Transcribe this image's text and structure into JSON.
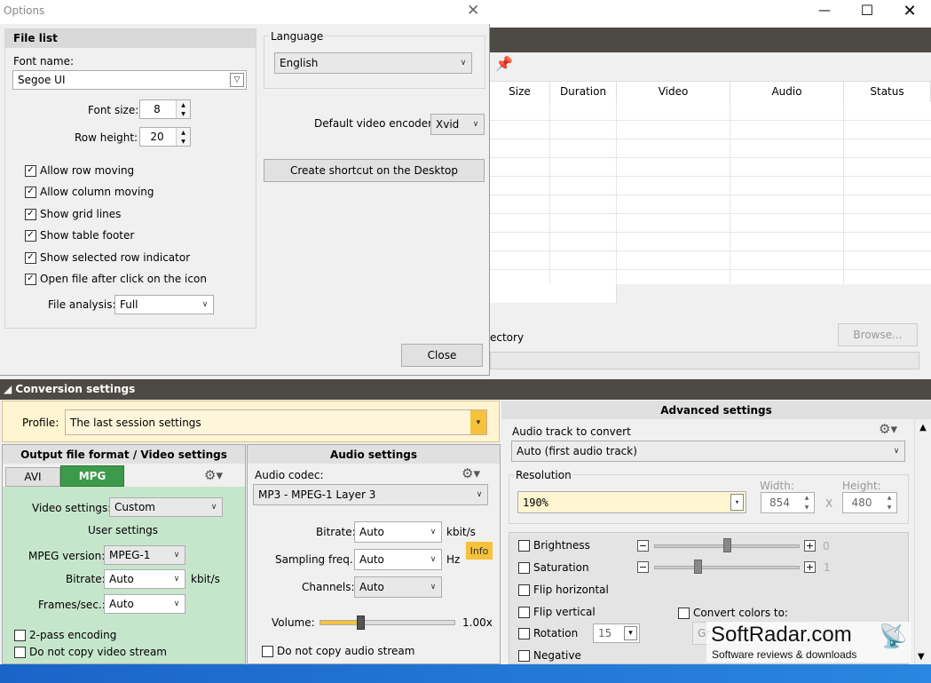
{
  "options": {
    "title": "Options",
    "file_list": {
      "header": "File list",
      "font_name_label": "Font name:",
      "font_name_value": "Segoe UI",
      "font_size_label": "Font size:",
      "font_size_value": "8",
      "row_height_label": "Row height:",
      "row_height_value": "20",
      "checks": [
        {
          "label": "Allow row moving",
          "checked": true
        },
        {
          "label": "Allow column moving",
          "checked": true
        },
        {
          "label": "Show grid lines",
          "checked": true
        },
        {
          "label": "Show table footer",
          "checked": true
        },
        {
          "label": "Show selected row indicator",
          "checked": true
        },
        {
          "label": "Open file after click on the icon",
          "checked": true
        }
      ],
      "file_analysis_label": "File analysis:",
      "file_analysis_value": "Full"
    },
    "language": {
      "header": "Language",
      "value": "English",
      "default_encoder_label": "Default video encoder:",
      "default_encoder_value": "Xvid",
      "shortcut_button": "Create shortcut on the Desktop"
    },
    "close_button": "Close"
  },
  "main": {
    "columns": [
      "Size",
      "Duration",
      "Video",
      "Audio",
      "Status"
    ],
    "directory_label": "ectory",
    "browse_button": "Browse..."
  },
  "conversion": {
    "header": "Conversion settings",
    "profile_label": "Profile:",
    "profile_value": "The last session settings",
    "output": {
      "header": "Output file format / Video settings",
      "tabs": [
        "AVI",
        "MPG"
      ],
      "video_settings_label": "Video settings:",
      "video_settings_value": "Custom",
      "user_settings": "User settings",
      "mpeg_version_label": "MPEG version:",
      "mpeg_version_value": "MPEG-1",
      "bitrate_label": "Bitrate:",
      "bitrate_value": "Auto",
      "bitrate_unit": "kbit/s",
      "fps_label": "Frames/sec.:",
      "fps_value": "Auto",
      "two_pass": "2-pass encoding",
      "no_copy_video": "Do not copy video stream"
    },
    "audio": {
      "header": "Audio settings",
      "codec_label": "Audio codec:",
      "codec_value": "MP3 - MPEG-1 Layer 3",
      "bitrate_label": "Bitrate:",
      "bitrate_value": "Auto",
      "bitrate_unit": "kbit/s",
      "info": "Info",
      "freq_label": "Sampling freq.:",
      "freq_value": "Auto",
      "freq_unit": "Hz",
      "channels_label": "Channels:",
      "channels_value": "Auto",
      "volume_label": "Volume:",
      "volume_value": "1.00x",
      "volume_level": 0.3,
      "no_copy_audio": "Do not copy audio stream"
    },
    "advanced": {
      "header": "Advanced settings",
      "audio_track_label": "Audio track to convert",
      "audio_track_value": "Auto (first audio track)",
      "resolution_label": "Resolution",
      "resolution_value": "190%",
      "width_label": "Width:",
      "width_value": "854",
      "height_label": "Height:",
      "height_value": "480",
      "x_sep": "X",
      "brightness": "Brightness",
      "brightness_value": "0",
      "saturation": "Saturation",
      "saturation_value": "1",
      "flip_h": "Flip horizontal",
      "flip_v": "Flip vertical",
      "convert_colors": "Convert colors to:",
      "gray": "Gr",
      "rotation": "Rotation",
      "rotation_value": "15",
      "negative": "Negative"
    }
  },
  "watermark": {
    "name": "SoftRadar.com",
    "tagline": "Software reviews & downloads"
  },
  "colors": {
    "accent_green": "#3c9a4a",
    "profile_bg": "#fff5d0",
    "dark_band": "#4d4a45"
  }
}
